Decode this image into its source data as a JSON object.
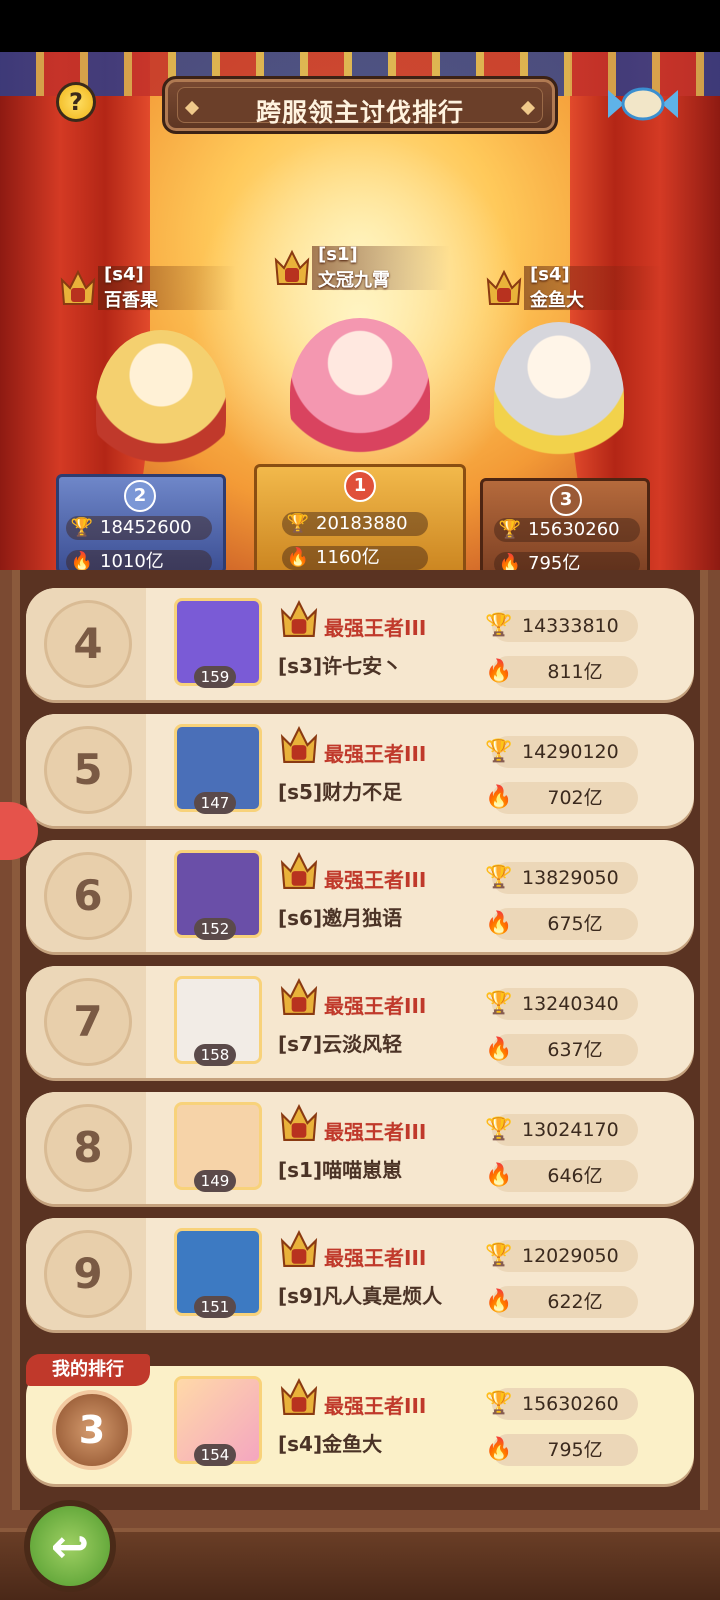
{
  "header": {
    "title": "跨服领主讨伐排行"
  },
  "podium": [
    {
      "place": "2",
      "server": "[s4]",
      "name": "百香果",
      "trophy": "18452600",
      "power": "1010亿"
    },
    {
      "place": "1",
      "server": "[s1]",
      "name": "文冠九霄",
      "trophy": "20183880",
      "power": "1160亿"
    },
    {
      "place": "3",
      "server": "[s4]",
      "name": "金鱼大",
      "trophy": "15630260",
      "power": "795亿"
    }
  ],
  "rows": [
    {
      "rank": "4",
      "level": "159",
      "tier": "最强王者III",
      "name": "[s3]许七安丶",
      "trophy": "14333810",
      "power": "811亿"
    },
    {
      "rank": "5",
      "level": "147",
      "tier": "最强王者III",
      "name": "[s5]财力不足",
      "trophy": "14290120",
      "power": "702亿"
    },
    {
      "rank": "6",
      "level": "152",
      "tier": "最强王者III",
      "name": "[s6]邀月独语",
      "trophy": "13829050",
      "power": "675亿"
    },
    {
      "rank": "7",
      "level": "158",
      "tier": "最强王者III",
      "name": "[s7]云淡风轻",
      "trophy": "13240340",
      "power": "637亿"
    },
    {
      "rank": "8",
      "level": "149",
      "tier": "最强王者III",
      "name": "[s1]喵喵崽崽",
      "trophy": "13024170",
      "power": "646亿"
    },
    {
      "rank": "9",
      "level": "151",
      "tier": "最强王者III",
      "name": "[s9]凡人真是烦人",
      "trophy": "12029050",
      "power": "622亿"
    }
  ],
  "my_rank": {
    "label": "我的排行",
    "rank": "3",
    "level": "154",
    "tier": "最强王者III",
    "name": "[s4]金鱼大",
    "trophy": "15630260",
    "power": "795亿"
  },
  "icons": {
    "help": "question-icon",
    "back": "back-arrow-icon",
    "trophy": "trophy-icon",
    "power": "flame-icon",
    "tier": "crown-badge-icon"
  },
  "colors": {
    "tier_text": "#c0392b",
    "row_bg": "#f6e7cf",
    "frame": "#5a3322"
  }
}
